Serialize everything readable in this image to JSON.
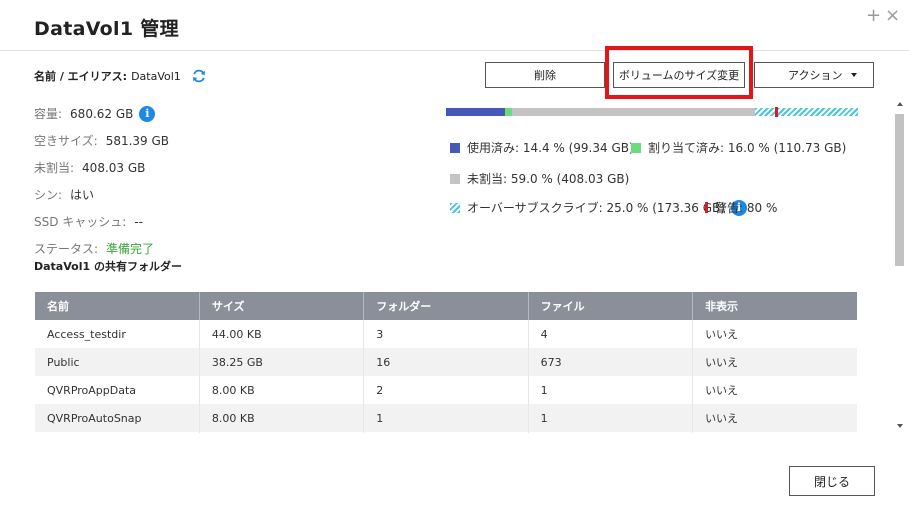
{
  "dialog": {
    "title": "DataVol1  管理",
    "maximize_glyph": "+",
    "close_glyph": "×"
  },
  "volume": {
    "name_label": "名前 / エイリアス:",
    "name_value": "DataVol1"
  },
  "info": {
    "capacity_label": "容量:",
    "capacity_value": "680.62 GB",
    "free_label": "空きサイズ:",
    "free_value": "581.39 GB",
    "unallocated_label": "未割当:",
    "unallocated_value": "408.03 GB",
    "thin_label": "シン:",
    "thin_value": "はい",
    "ssd_cache_label": "SSD キャッシュ:",
    "ssd_cache_value": "--",
    "status_label": "ステータス:",
    "status_value": "準備完了",
    "status_color": "#3fa33f"
  },
  "actions": {
    "delete_label": "削除",
    "resize_label": "ボリュームのサイズ変更",
    "action_label": "アクション",
    "close_label": "閉じる"
  },
  "usage": {
    "used_percent": 14.4,
    "allocated_percent": 16.0,
    "unallocated_percent": 59.0,
    "oversubscribed_percent": 25.0,
    "warning_threshold_percent": 80,
    "colors": {
      "used": "#4558b8",
      "allocated": "#6ddb7d",
      "unallocated": "#c4c4c4",
      "oversubscribed": "#45c6dc",
      "warning": "#d81b24"
    },
    "legend": {
      "used": "使用済み: 14.4 % (99.34 GB)",
      "allocated": "割り当て済み: 16.0 % (110.73 GB)",
      "unallocated": "未割当: 59.0 % (408.03 GB)",
      "oversubscribed": "オーバーサブスクライブ: 25.0 % (173.36 GB)",
      "warning": "警告: 80 %"
    }
  },
  "shared_folders": {
    "title": "DataVol1 の共有フォルダー",
    "columns": [
      "名前",
      "サイズ",
      "フォルダー",
      "ファイル",
      "非表示"
    ],
    "rows": [
      [
        "Access_testdir",
        "44.00 KB",
        "3",
        "4",
        "いいえ"
      ],
      [
        "Public",
        "38.25 GB",
        "16",
        "673",
        "いいえ"
      ],
      [
        "QVRProAppData",
        "8.00 KB",
        "2",
        "1",
        "いいえ"
      ],
      [
        "QVRProAutoSnap",
        "8.00 KB",
        "1",
        "1",
        "いいえ"
      ],
      [
        "",
        "",
        "",
        "",
        ""
      ]
    ]
  }
}
